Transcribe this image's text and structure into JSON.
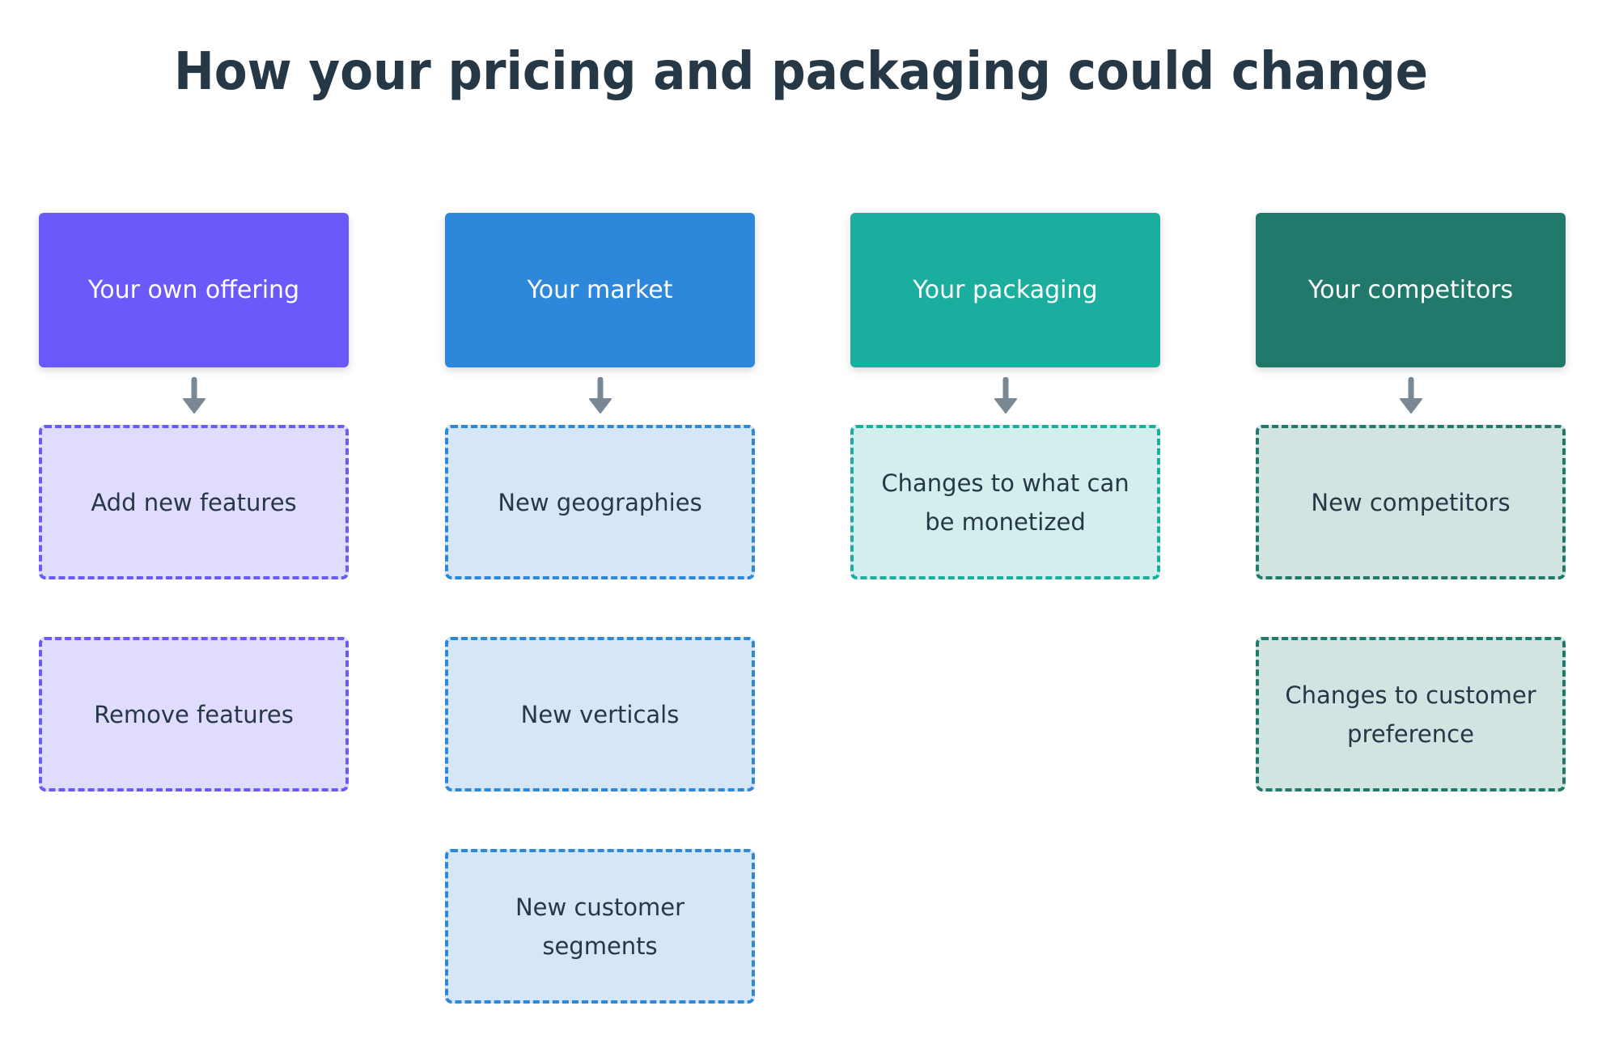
{
  "title": "How your pricing and packaging could change",
  "columns": [
    {
      "header": "Your own offering",
      "color": "#6a5af9",
      "sub_bg": "#dfdcfd",
      "items": [
        "Add new features",
        "Remove features"
      ]
    },
    {
      "header": "Your market",
      "color": "#2d88da",
      "sub_bg": "#d5e6f6",
      "items": [
        "New geographies",
        "New verticals",
        "New customer segments"
      ]
    },
    {
      "header": "Your packaging",
      "color": "#1bae9f",
      "sub_bg": "#d2efed",
      "items": [
        "Changes to what can be monetized"
      ]
    },
    {
      "header": "Your competitors",
      "color": "#20796a",
      "sub_bg": "#d2e4e1",
      "items": [
        "New competitors",
        "Changes to customer preference"
      ]
    }
  ],
  "arrow_color": "#7a8896"
}
